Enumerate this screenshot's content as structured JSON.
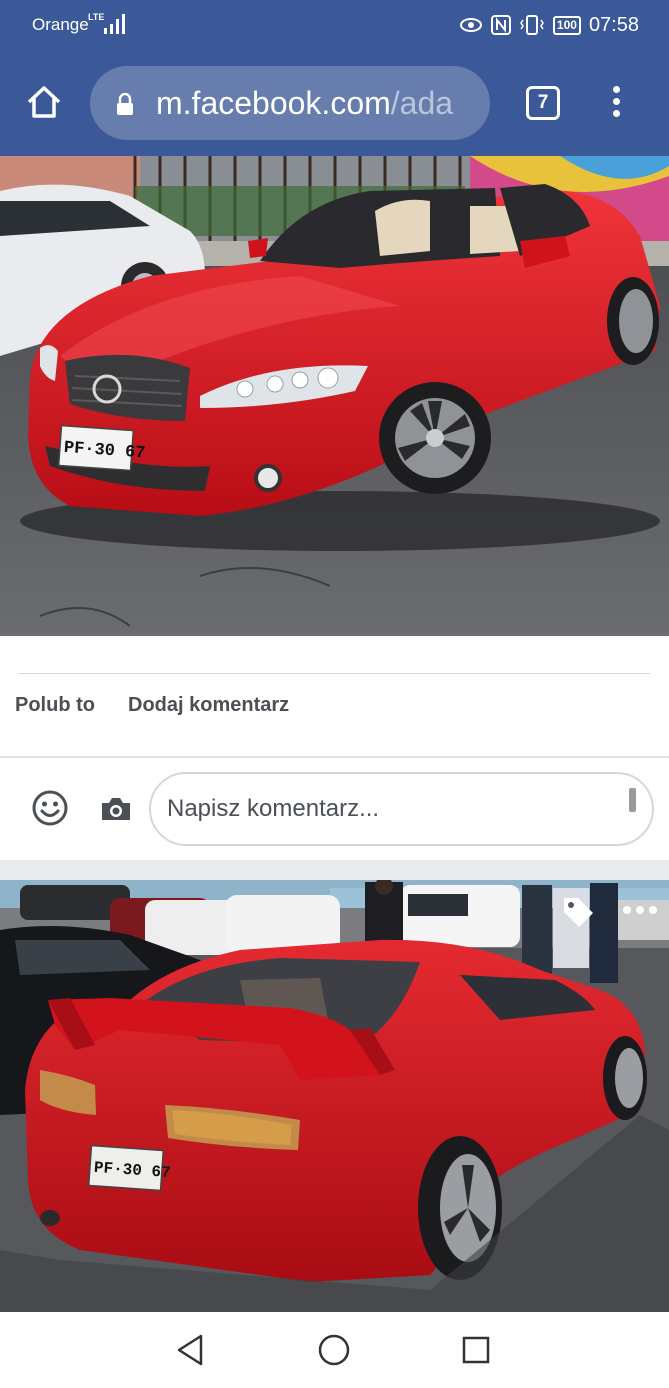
{
  "status_bar": {
    "carrier": "Orange",
    "network": "LTE",
    "battery": "100",
    "time": "07:58",
    "icons": [
      "signal-icon",
      "eye-icon",
      "nfc-icon",
      "vibrate-icon",
      "battery-icon"
    ]
  },
  "browser": {
    "url_domain": "m.facebook.com",
    "url_path": "/ada",
    "tab_count": "7",
    "icons": [
      "home-icon",
      "lock-icon",
      "tabs-icon",
      "more-vert-icon"
    ]
  },
  "post": {
    "photo1": {
      "subject": "red-car-front-license-plate",
      "plate": "PF·30 67"
    },
    "actions": {
      "like": "Polub to",
      "comment": "Dodaj komentarz"
    },
    "comment_box": {
      "placeholder": "Napisz komentarz...",
      "icons": [
        "smiley-icon",
        "camera-icon"
      ]
    },
    "photo2": {
      "subject": "red-car-rear-license-plate",
      "plate": "PF·30 67",
      "icons": [
        "tag-icon",
        "more-horiz-icon"
      ]
    }
  },
  "navigation": {
    "icons": [
      "back-icon",
      "home-circle-icon",
      "recents-icon"
    ]
  },
  "colors": {
    "facebook_blue": "#3b5998",
    "car_red": "#d9141e",
    "asphalt": "#5a5c60",
    "action_text": "#4b4f56"
  }
}
